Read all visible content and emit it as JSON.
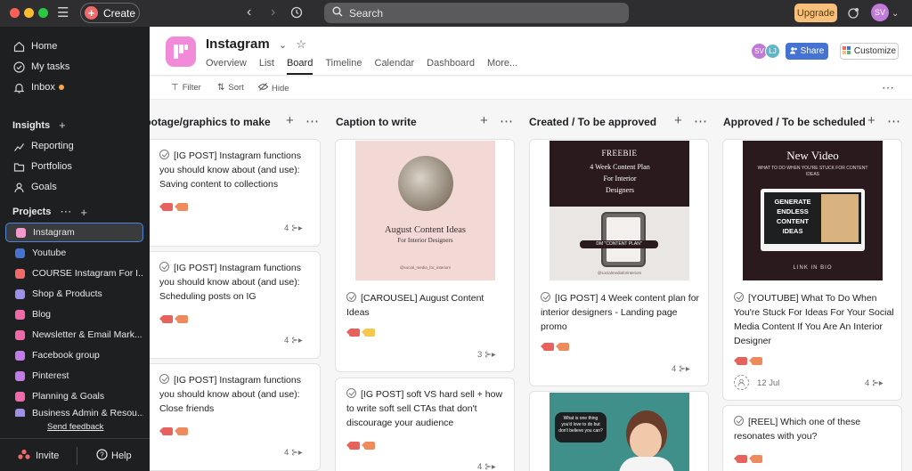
{
  "topbar": {
    "create_label": "Create",
    "search_placeholder": "Search",
    "upgrade_label": "Upgrade",
    "user_initials": "SV"
  },
  "sidebar": {
    "nav": [
      {
        "label": "Home",
        "icon": "home-icon"
      },
      {
        "label": "My tasks",
        "icon": "check-circle-icon"
      },
      {
        "label": "Inbox",
        "icon": "bell-icon"
      }
    ],
    "insights_heading": "Insights",
    "insights": [
      {
        "label": "Reporting",
        "icon": "chart-icon"
      },
      {
        "label": "Portfolios",
        "icon": "folder-icon"
      },
      {
        "label": "Goals",
        "icon": "person-icon"
      }
    ],
    "projects_heading": "Projects",
    "projects": [
      {
        "label": "Instagram",
        "color": "#f49ad1"
      },
      {
        "label": "Youtube",
        "color": "#4573d2"
      },
      {
        "label": "COURSE Instagram For I...",
        "color": "#f06a6a"
      },
      {
        "label": "Shop & Products",
        "color": "#9e8fe8"
      },
      {
        "label": "Blog",
        "color": "#f06aa9"
      },
      {
        "label": "Newsletter & Email Mark...",
        "color": "#f06aa9"
      },
      {
        "label": "Facebook group",
        "color": "#c27ce8"
      },
      {
        "label": "Pinterest",
        "color": "#c27ce8"
      },
      {
        "label": "Planning & Goals",
        "color": "#f06aa9"
      },
      {
        "label": "Business Admin & Resou...",
        "color": "#9e8fe8"
      }
    ],
    "feedback_label": "Send feedback",
    "invite_label": "Invite",
    "help_label": "Help"
  },
  "header": {
    "project_title": "Instagram",
    "tabs": [
      "Overview",
      "List",
      "Board",
      "Timeline",
      "Calendar",
      "Dashboard",
      "More..."
    ],
    "active_tab": "Board",
    "share_label": "Share",
    "customize_label": "Customize",
    "members": [
      {
        "initials": "SV",
        "color": "#c07bd8"
      },
      {
        "initials": "LJ",
        "color": "#5fb7c9"
      }
    ]
  },
  "toolbar": {
    "filter_label": "Filter",
    "sort_label": "Sort",
    "hide_label": "Hide"
  },
  "board": {
    "columns": [
      {
        "title": "Footage/graphics to make",
        "cards": [
          {
            "title": "[IG POST] Instagram functions you should know about (and use): Saving content to collections",
            "subtasks": "4"
          },
          {
            "title": "[IG POST] Instagram functions you should know about (and use): Scheduling posts on IG",
            "subtasks": "4"
          },
          {
            "title": "[IG POST] Instagram functions you should know about (and use): Close friends",
            "subtasks": "4"
          }
        ]
      },
      {
        "title": "Caption to write",
        "cards": [
          {
            "title": "[CAROUSEL] August Content Ideas",
            "subtasks": "3",
            "image": {
              "heading": "August Content Ideas",
              "subheading": "For Interior Designers",
              "footer": "@social_media_for_interiors"
            }
          },
          {
            "title": "[IG POST] soft VS hard sell + how to write soft sell CTAs that don't discourage your audience",
            "subtasks": "4"
          }
        ]
      },
      {
        "title": "Created / To be approved",
        "cards": [
          {
            "title": "[IG POST] 4 Week content plan for interior designers - Landing page promo",
            "subtasks": "4",
            "image": {
              "kicker": "FREEBIE",
              "heading": "4 Week Content Plan For Interior Designers",
              "cta": "DM \"CONTENT PLAN\"",
              "footer": "@socialmediaforinteriors"
            }
          },
          {
            "title": "",
            "image": {
              "bubble": "What is one thing you'd love to do but don't believe you can?"
            }
          }
        ]
      },
      {
        "title": "Approved / To be scheduled",
        "cards": [
          {
            "title": "[YOUTUBE] What To Do When You're Stuck For Ideas For Your Social Media Content If You Are An Interior Designer",
            "subtasks": "4",
            "due": "12 Jul",
            "image": {
              "heading": "New Video",
              "subheading": "WHAT TO DO WHEN YOU'RE STUCK FOR CONTENT IDEAS",
              "screen_text": [
                "GENERATE",
                "ENDLESS",
                "CONTENT",
                "IDEAS"
              ],
              "footer": "LINK IN BIO"
            }
          },
          {
            "title": "[REEL] Which one of these resonates with you?",
            "subtasks": ""
          }
        ]
      }
    ]
  }
}
